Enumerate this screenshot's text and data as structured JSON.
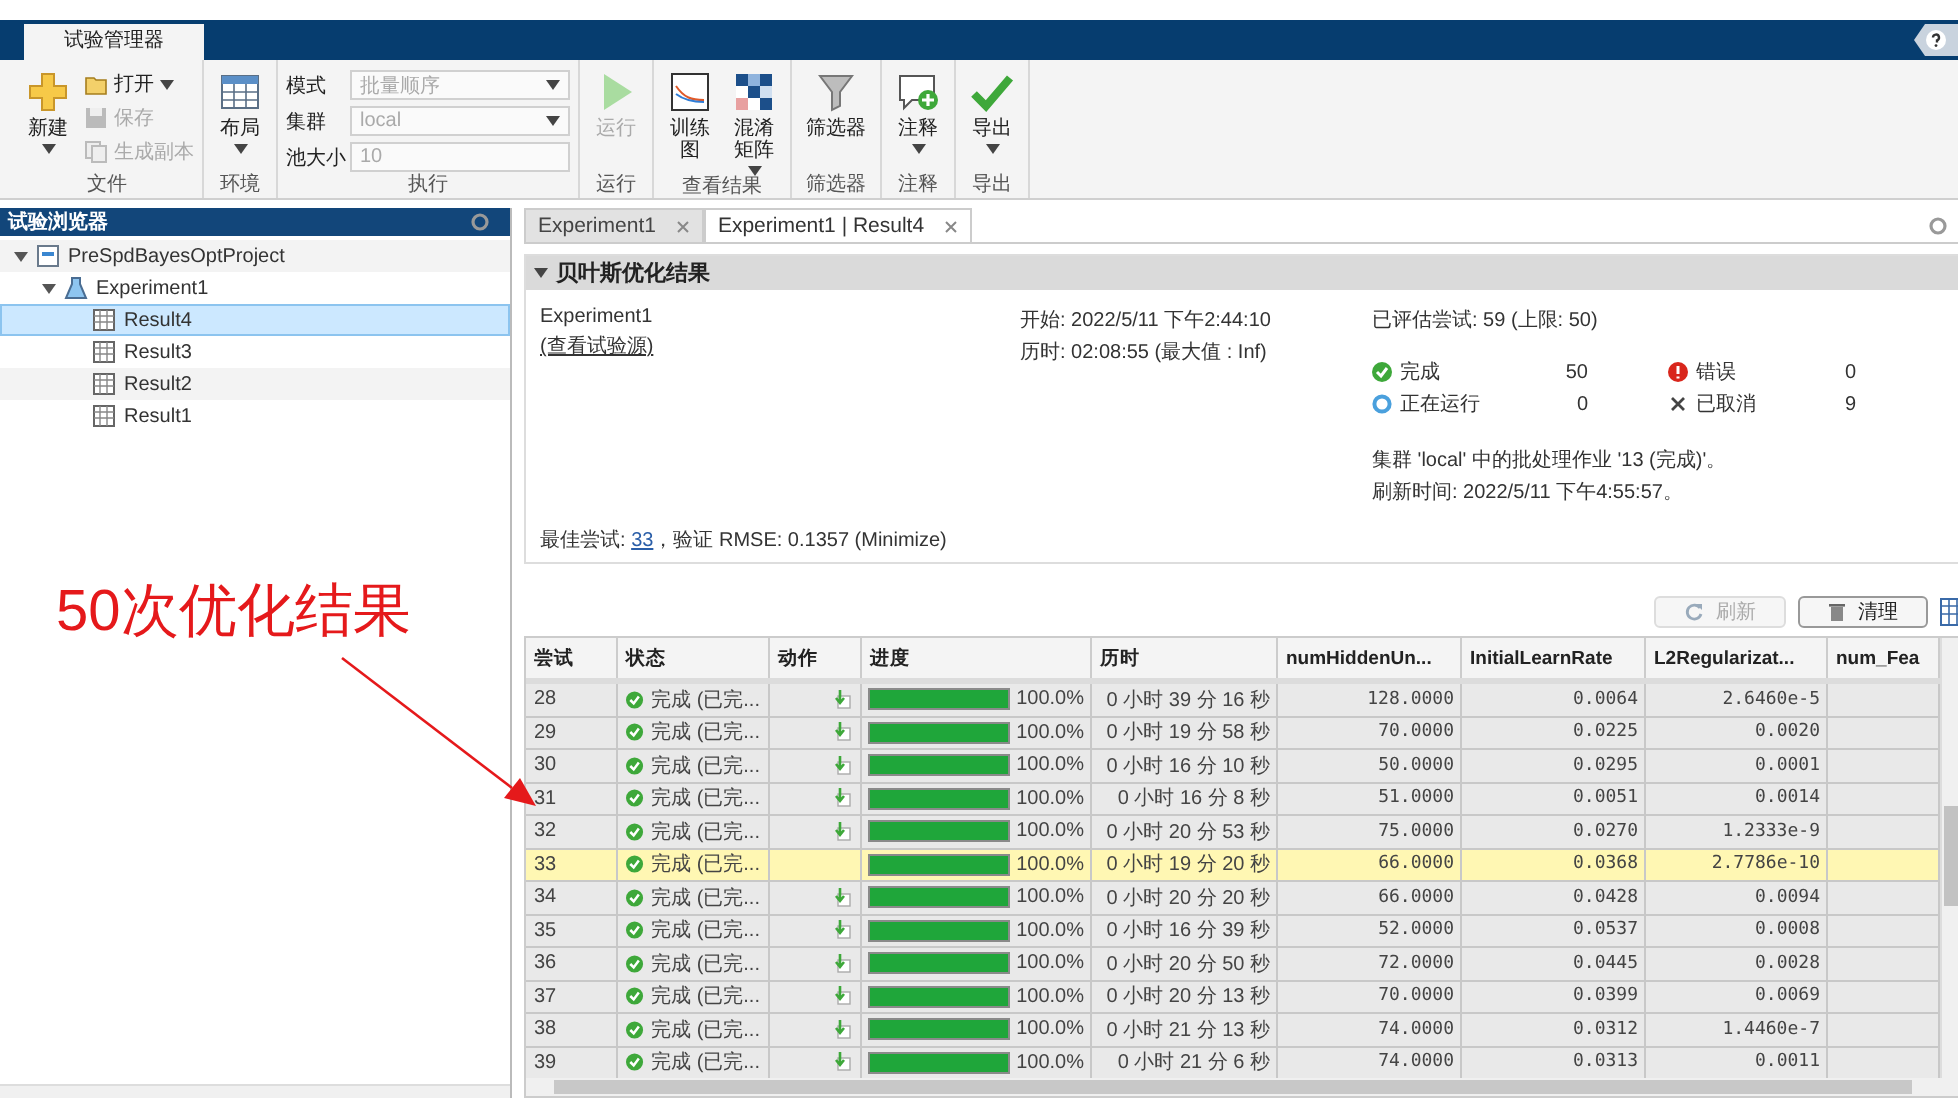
{
  "ribbon": {
    "tab": "试验管理器",
    "groups": [
      {
        "label": "文件",
        "items": [
          {
            "kind": "large",
            "label": "新建",
            "dropdown": true,
            "disabled": false
          },
          {
            "kind": "small",
            "label": "打开",
            "dropdown": true,
            "disabled": false
          },
          {
            "kind": "small",
            "label": "保存",
            "dropdown": false,
            "disabled": true
          },
          {
            "kind": "small",
            "label": "生成副本",
            "dropdown": false,
            "disabled": true
          }
        ]
      },
      {
        "label": "环境",
        "items": [
          {
            "kind": "large",
            "label": "布局",
            "dropdown": true,
            "disabled": false
          }
        ]
      },
      {
        "label": "执行",
        "items": [
          {
            "kind": "field",
            "label": "模式",
            "value": "批量顺序",
            "dropdown": true,
            "disabled": true
          },
          {
            "kind": "field",
            "label": "集群",
            "value": "local",
            "dropdown": true,
            "disabled": true
          },
          {
            "kind": "field",
            "label": "池大小",
            "value": "10",
            "dropdown": false,
            "disabled": true
          }
        ]
      },
      {
        "label": "运行",
        "items": [
          {
            "kind": "large",
            "label": "运行",
            "dropdown": false,
            "disabled": true
          }
        ]
      },
      {
        "label": "查看结果",
        "items": [
          {
            "kind": "stacked",
            "label": "训练图",
            "dropdown": false,
            "disabled": false
          },
          {
            "kind": "stacked",
            "label": "混淆矩阵",
            "dropdown": true,
            "disabled": false
          }
        ]
      },
      {
        "label": "筛选器",
        "items": [
          {
            "kind": "large",
            "label": "筛选器",
            "dropdown": false,
            "disabled": false
          }
        ]
      },
      {
        "label": "注释",
        "items": [
          {
            "kind": "large",
            "label": "注释",
            "dropdown": true,
            "disabled": false
          }
        ]
      },
      {
        "label": "导出",
        "items": [
          {
            "kind": "large",
            "label": "导出",
            "dropdown": true,
            "disabled": false
          }
        ]
      }
    ]
  },
  "browser": {
    "title": "试验浏览器",
    "tree": [
      {
        "label": "PreSpdBayesOptProject",
        "expanded": true,
        "selected": false,
        "children": [
          {
            "label": "Experiment1",
            "expanded": true,
            "selected": false,
            "children": [
              {
                "label": "Result4",
                "selected": true
              },
              {
                "label": "Result3",
                "selected": false
              },
              {
                "label": "Result2",
                "selected": false
              },
              {
                "label": "Result1",
                "selected": false
              }
            ]
          }
        ]
      }
    ]
  },
  "annotation": {
    "text": "50次优化结果"
  },
  "tabs": [
    {
      "label": "Experiment1",
      "selected": false
    },
    {
      "label": "Experiment1 | Result4",
      "selected": true
    }
  ],
  "summary": {
    "title": "贝叶斯优化结果",
    "expanded": true,
    "experiment": "Experiment1",
    "source_link": "(查看试验源)",
    "start": "开始: 2022/5/11 下午2:44:10",
    "elapsed": "历时: 02:08:55 (最大值 : Inf)",
    "evaluated": "已评估尝试: 59 (上限: 50)",
    "stats": [
      {
        "kind": "complete",
        "label": "完成",
        "count": "50"
      },
      {
        "kind": "error",
        "label": "错误",
        "count": "0"
      },
      {
        "kind": "running",
        "label": "正在运行",
        "count": "0"
      },
      {
        "kind": "canceled",
        "label": "已取消",
        "count": "9"
      }
    ],
    "cluster": "集群 'local' 中的批处理作业 '13 (完成)'。",
    "refresh_time": "刷新时间: 2022/5/11 下午4:55:57。",
    "best": {
      "prefix": "最佳尝试: ",
      "trial": "33",
      "suffix": "，验证 RMSE: 0.1357 (Minimize)"
    }
  },
  "toolbar": [
    {
      "label": "刷新",
      "disabled": true
    },
    {
      "label": "清理",
      "disabled": false
    }
  ],
  "table": {
    "columns": [
      "尝试",
      "状态",
      "动作",
      "进度",
      "历时",
      "numHiddenUn...",
      "InitialLearnRate",
      "L2Regularizat...",
      "num_Fea"
    ],
    "rows": [
      {
        "trial": "28",
        "status": "完成 (已完...",
        "action": true,
        "level": 1,
        "progress": "100.0%",
        "elapsed": "0 小时 39 分 16 秒",
        "hidden": "128.0000",
        "lr": "0.0064",
        "l2": "2.6460e-5",
        "selected": false
      },
      {
        "trial": "29",
        "status": "完成 (已完...",
        "action": true,
        "level": 1,
        "progress": "100.0%",
        "elapsed": "0 小时 19 分 58 秒",
        "hidden": "70.0000",
        "lr": "0.0225",
        "l2": "0.0020",
        "selected": false
      },
      {
        "trial": "30",
        "status": "完成 (已完...",
        "action": true,
        "level": 1,
        "progress": "100.0%",
        "elapsed": "0 小时 16 分 10 秒",
        "hidden": "50.0000",
        "lr": "0.0295",
        "l2": "0.0001",
        "selected": false
      },
      {
        "trial": "31",
        "status": "完成 (已完...",
        "action": true,
        "level": 1,
        "progress": "100.0%",
        "elapsed": "0 小时 16 分 8 秒",
        "hidden": "51.0000",
        "lr": "0.0051",
        "l2": "0.0014",
        "selected": false
      },
      {
        "trial": "32",
        "status": "完成 (已完...",
        "action": true,
        "level": 1,
        "progress": "100.0%",
        "elapsed": "0 小时 20 分 53 秒",
        "hidden": "75.0000",
        "lr": "0.0270",
        "l2": "1.2333e-9",
        "selected": false
      },
      {
        "trial": "33",
        "status": "完成 (已完...",
        "action": false,
        "level": 1,
        "progress": "100.0%",
        "elapsed": "0 小时 19 分 20 秒",
        "hidden": "66.0000",
        "lr": "0.0368",
        "l2": "2.7786e-10",
        "selected": true
      },
      {
        "trial": "34",
        "status": "完成 (已完...",
        "action": true,
        "level": 1,
        "progress": "100.0%",
        "elapsed": "0 小时 20 分 20 秒",
        "hidden": "66.0000",
        "lr": "0.0428",
        "l2": "0.0094",
        "selected": false
      },
      {
        "trial": "35",
        "status": "完成 (已完...",
        "action": true,
        "level": 1,
        "progress": "100.0%",
        "elapsed": "0 小时 16 分 39 秒",
        "hidden": "52.0000",
        "lr": "0.0537",
        "l2": "0.0008",
        "selected": false
      },
      {
        "trial": "36",
        "status": "完成 (已完...",
        "action": true,
        "level": 1,
        "progress": "100.0%",
        "elapsed": "0 小时 20 分 50 秒",
        "hidden": "72.0000",
        "lr": "0.0445",
        "l2": "0.0028",
        "selected": false
      },
      {
        "trial": "37",
        "status": "完成 (已完...",
        "action": true,
        "level": 1,
        "progress": "100.0%",
        "elapsed": "0 小时 20 分 13 秒",
        "hidden": "70.0000",
        "lr": "0.0399",
        "l2": "0.0069",
        "selected": false
      },
      {
        "trial": "38",
        "status": "完成 (已完...",
        "action": true,
        "level": 1,
        "progress": "100.0%",
        "elapsed": "0 小时 21 分 13 秒",
        "hidden": "74.0000",
        "lr": "0.0312",
        "l2": "1.4460e-7",
        "selected": false
      },
      {
        "trial": "39",
        "status": "完成 (已完...",
        "action": true,
        "level": 1,
        "progress": "100.0%",
        "elapsed": "0 小时 21 分 6 秒",
        "hidden": "74.0000",
        "lr": "0.0313",
        "l2": "0.0011",
        "selected": false
      }
    ]
  }
}
